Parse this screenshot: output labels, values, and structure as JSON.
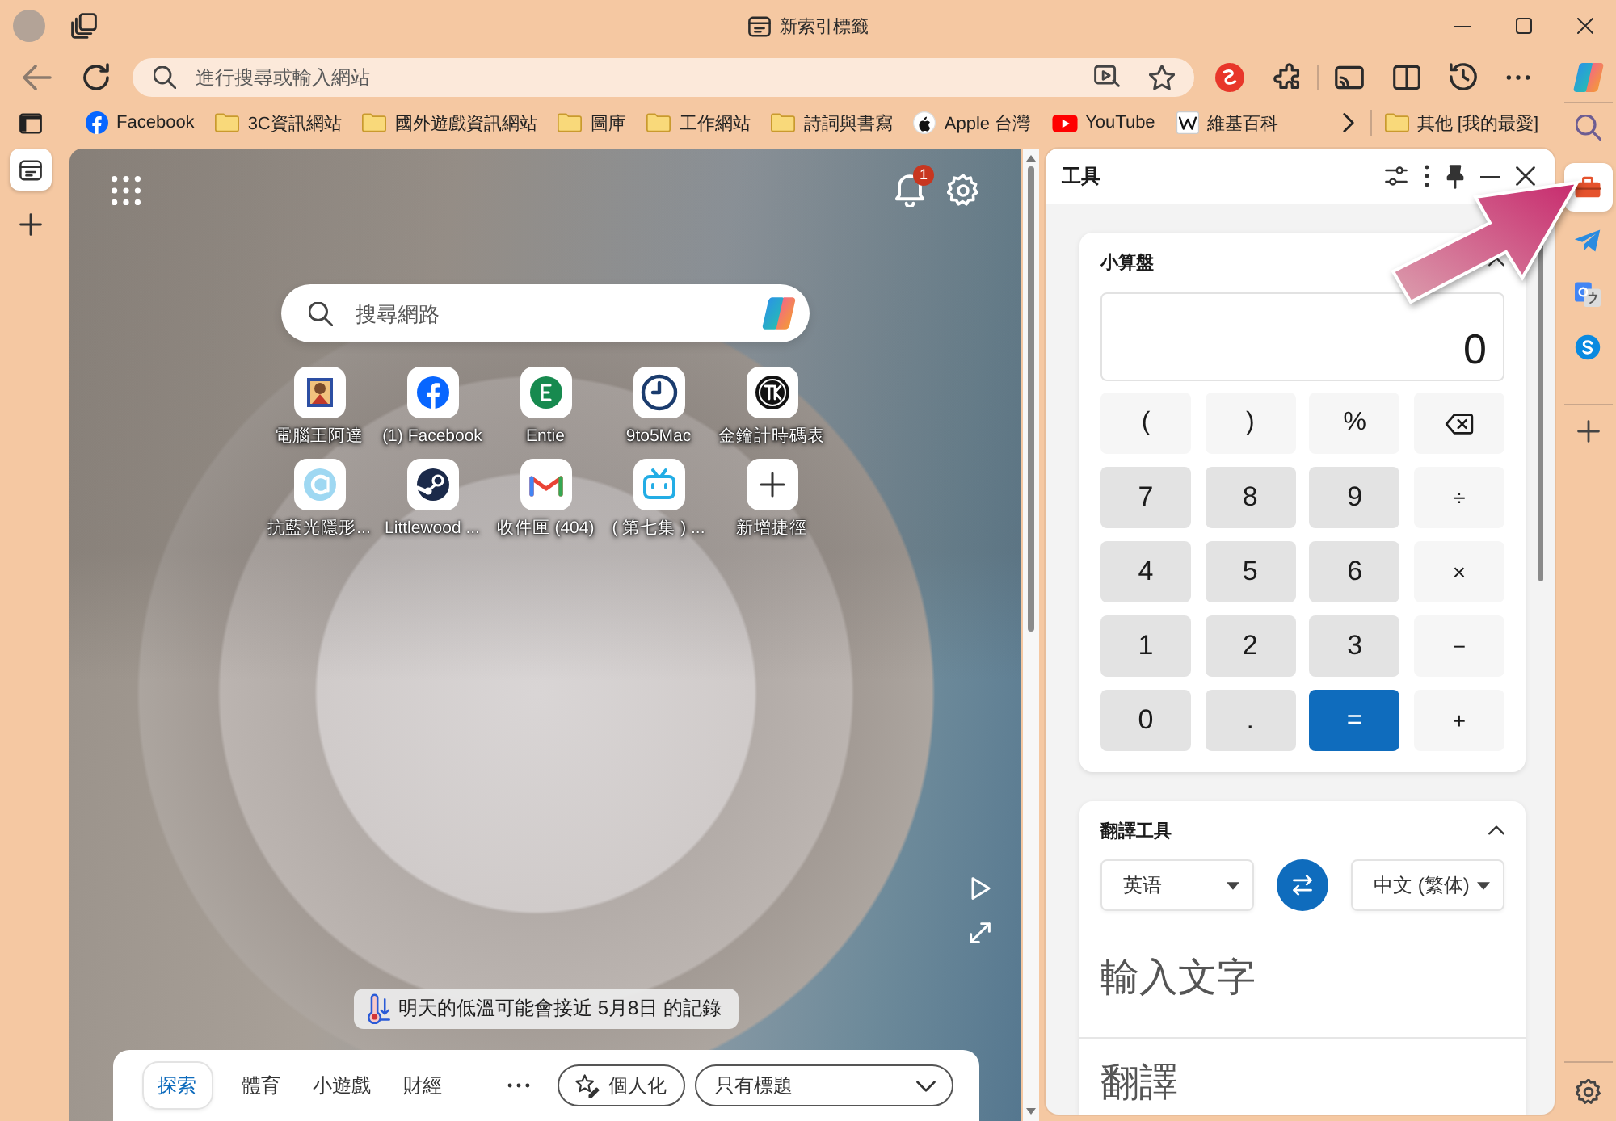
{
  "window": {
    "title": "新索引標籤"
  },
  "toolbar": {
    "address_bar": {
      "placeholder": "進行搜尋或輸入網站"
    }
  },
  "bookmarks": {
    "items": [
      {
        "kind": "site",
        "label": "Facebook"
      },
      {
        "kind": "folder",
        "label": "3C資訊網站"
      },
      {
        "kind": "folder",
        "label": "國外遊戲資訊網站"
      },
      {
        "kind": "folder",
        "label": "圖庫"
      },
      {
        "kind": "folder",
        "label": "工作網站"
      },
      {
        "kind": "folder",
        "label": "詩詞與書寫"
      },
      {
        "kind": "site",
        "label": "Apple 台灣"
      },
      {
        "kind": "site",
        "label": "YouTube"
      },
      {
        "kind": "site",
        "label": "維基百科"
      }
    ],
    "other": {
      "kind": "folder",
      "label": "其他 [我的最愛]"
    }
  },
  "vertical_tabs": [
    {
      "selected": true
    }
  ],
  "new_tab": {
    "notification_count": "1",
    "search": {
      "placeholder": "搜尋網路"
    },
    "shortcuts": [
      {
        "kind": "site",
        "label": "電腦王阿達"
      },
      {
        "kind": "site",
        "label": "(1) Facebook"
      },
      {
        "kind": "site",
        "label": "Entie"
      },
      {
        "kind": "site",
        "label": "9to5Mac"
      },
      {
        "kind": "site",
        "label": "金鑰計時碼表"
      },
      {
        "kind": "site",
        "label": "抗藍光隱形..."
      },
      {
        "kind": "site",
        "label": "Littlewood ..."
      },
      {
        "kind": "site",
        "label": "收件匣 (404)"
      },
      {
        "kind": "site",
        "label": "( 第七集 ) ..."
      },
      {
        "kind": "add",
        "label": "新增捷徑"
      }
    ],
    "weather_alert": "明天的低溫可能會接近 5月8日 的記錄",
    "feed_tabs": [
      {
        "label": "探索",
        "selected": true
      },
      {
        "label": "體育",
        "selected": false
      },
      {
        "label": "小遊戲",
        "selected": false
      },
      {
        "label": "財經",
        "selected": false
      }
    ],
    "personalize_button": "個人化",
    "layout_select": {
      "value": "只有標題"
    }
  },
  "tools_panel": {
    "title": "工具",
    "calculator": {
      "title": "小算盤",
      "display": "0",
      "keys": [
        {
          "kind": "function",
          "label": "("
        },
        {
          "kind": "function",
          "label": ")"
        },
        {
          "kind": "function",
          "label": "%"
        },
        {
          "kind": "backspace"
        },
        {
          "kind": "digit",
          "label": "7"
        },
        {
          "kind": "digit",
          "label": "8"
        },
        {
          "kind": "digit",
          "label": "9"
        },
        {
          "kind": "operator",
          "label": "÷"
        },
        {
          "kind": "digit",
          "label": "4"
        },
        {
          "kind": "digit",
          "label": "5"
        },
        {
          "kind": "digit",
          "label": "6"
        },
        {
          "kind": "operator",
          "label": "×"
        },
        {
          "kind": "digit",
          "label": "1"
        },
        {
          "kind": "digit",
          "label": "2"
        },
        {
          "kind": "digit",
          "label": "3"
        },
        {
          "kind": "operator",
          "label": "−"
        },
        {
          "kind": "digit",
          "label": "0"
        },
        {
          "kind": "digit",
          "label": "."
        },
        {
          "kind": "equals",
          "label": "="
        },
        {
          "kind": "operator",
          "label": "+"
        }
      ]
    },
    "translator": {
      "title": "翻譯工具",
      "source_language": "英语",
      "target_language": "中文 (繁体)",
      "input": {
        "placeholder": "輸入文字"
      },
      "output": {
        "placeholder": "翻譯"
      }
    }
  },
  "sidebar": {
    "apps": [
      {
        "selected": true
      },
      {
        "selected": false
      },
      {
        "selected": false
      },
      {
        "selected": false
      }
    ]
  }
}
